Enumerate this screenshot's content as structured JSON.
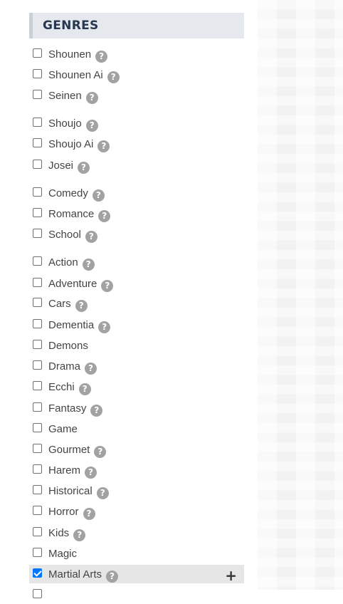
{
  "panel": {
    "title": "GENRES",
    "help_glyph": "?",
    "expand_glyph": "+"
  },
  "genres": [
    {
      "label": "Shounen",
      "checked": false,
      "help": true
    },
    {
      "label": "Shounen Ai",
      "checked": false,
      "help": true
    },
    {
      "label": "Seinen",
      "checked": false,
      "help": true
    },
    {
      "label": "Shoujo",
      "checked": false,
      "help": true
    },
    {
      "label": "Shoujo Ai",
      "checked": false,
      "help": true
    },
    {
      "label": "Josei",
      "checked": false,
      "help": true
    },
    {
      "label": "Comedy",
      "checked": false,
      "help": true
    },
    {
      "label": "Romance",
      "checked": false,
      "help": true
    },
    {
      "label": "School",
      "checked": false,
      "help": true
    },
    {
      "label": "Action",
      "checked": false,
      "help": true
    },
    {
      "label": "Adventure",
      "checked": false,
      "help": true
    },
    {
      "label": "Cars",
      "checked": false,
      "help": true
    },
    {
      "label": "Dementia",
      "checked": false,
      "help": true
    },
    {
      "label": "Demons",
      "checked": false,
      "help": false
    },
    {
      "label": "Drama",
      "checked": false,
      "help": true
    },
    {
      "label": "Ecchi",
      "checked": false,
      "help": true
    },
    {
      "label": "Fantasy",
      "checked": false,
      "help": true
    },
    {
      "label": "Game",
      "checked": false,
      "help": false
    },
    {
      "label": "Gourmet",
      "checked": false,
      "help": true
    },
    {
      "label": "Harem",
      "checked": false,
      "help": true
    },
    {
      "label": "Historical",
      "checked": false,
      "help": true
    },
    {
      "label": "Horror",
      "checked": false,
      "help": true
    },
    {
      "label": "Kids",
      "checked": false,
      "help": true
    },
    {
      "label": "Magic",
      "checked": false,
      "help": false
    },
    {
      "label": "Martial Arts",
      "checked": true,
      "help": true,
      "selected": true,
      "expand": true
    },
    {
      "label": "",
      "checked": false,
      "help": false
    }
  ]
}
